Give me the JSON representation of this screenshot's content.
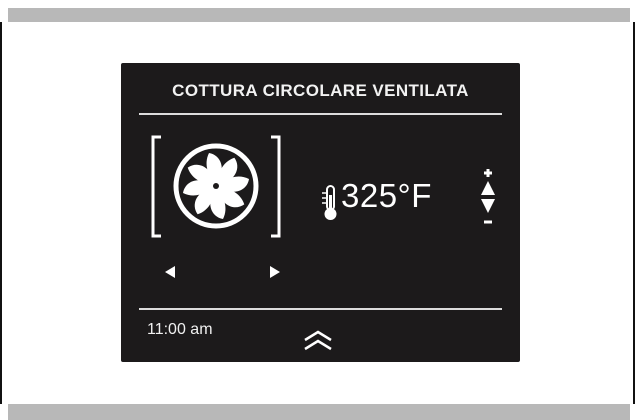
{
  "display": {
    "title": "COTTURA CIRCOLARE VENTILATA",
    "temperature": "325°F",
    "clock": "11:00 am"
  },
  "icons": {
    "mode": "fan-icon",
    "thermometer": "thermometer-icon",
    "prev": "arrow-left-icon",
    "next": "arrow-right-icon",
    "temp_up": "increase-icon",
    "temp_down": "decrease-icon",
    "expand": "double-chevron-up-icon"
  },
  "colors": {
    "screen_bg": "#1c1a1b",
    "text": "#ffffff",
    "frame_bars": "#b8b8b8"
  }
}
